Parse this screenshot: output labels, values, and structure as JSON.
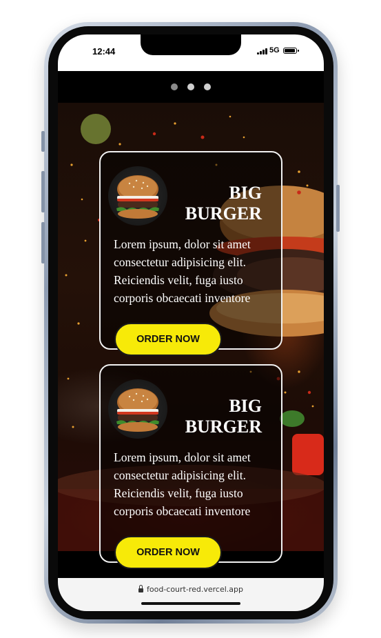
{
  "status_bar": {
    "time": "12:44",
    "network": "5G",
    "icons": [
      "signal-icon",
      "battery-icon"
    ]
  },
  "carousel": {
    "dots": 3,
    "active_index": 0
  },
  "cards": [
    {
      "title_line1": "BIG",
      "title_line2": "BURGER",
      "description": "Lorem ipsum, dolor sit amet consectetur adipisicing elit. Reiciendis velit, fuga iusto corporis obcaecati inventore repellat nihil mollitia ullam",
      "button_label": "ORDER NOW",
      "image_icon": "burger-icon"
    },
    {
      "title_line1": "BIG",
      "title_line2": "BURGER",
      "description": "Lorem ipsum, dolor sit amet consectetur adipisicing elit. Reiciendis velit, fuga iusto corporis obcaecati inventore repellat nihil mollitia ullam",
      "button_label": "ORDER NOW",
      "image_icon": "burger-icon"
    }
  ],
  "browser": {
    "url": "food-court-red.vercel.app"
  },
  "colors": {
    "button": "#f7ea08",
    "card_border": "#f2f2f2",
    "background": "#000000"
  }
}
